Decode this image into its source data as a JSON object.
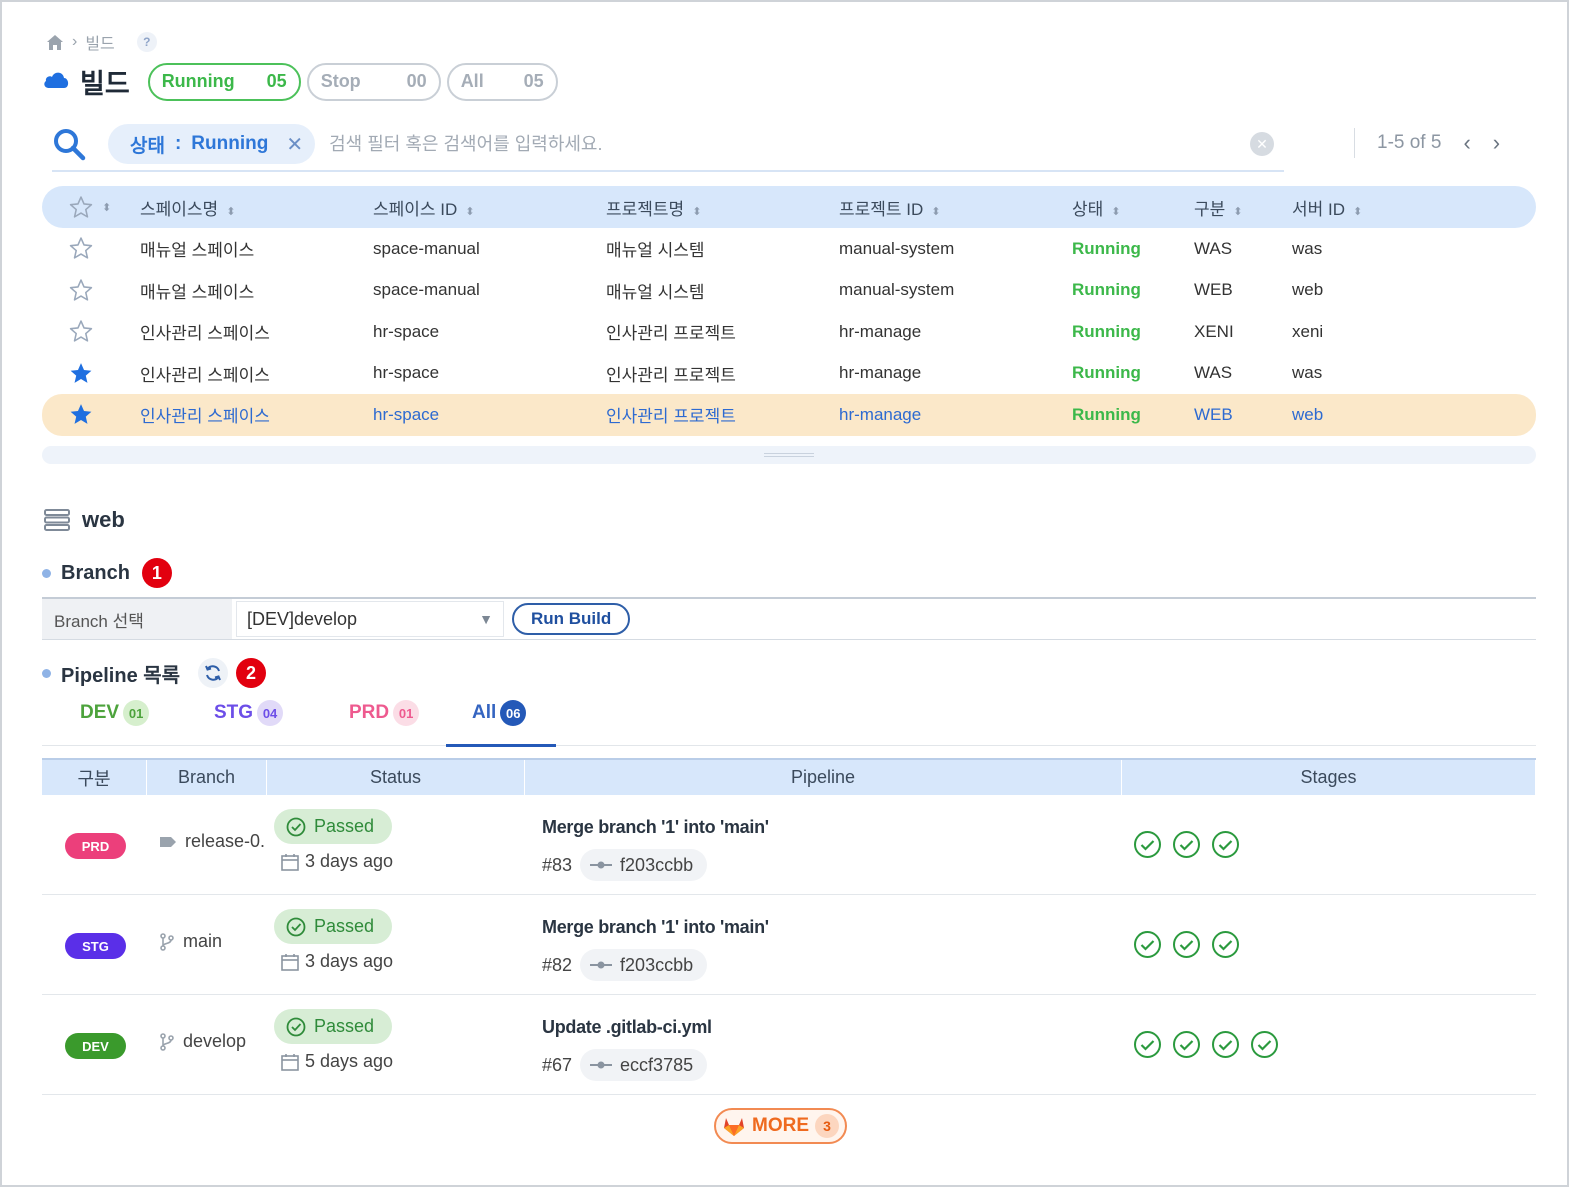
{
  "breadcrumb": {
    "current": "빌드",
    "help": "?"
  },
  "header": {
    "title": "빌드",
    "counters": [
      {
        "label": "Running",
        "count": "05"
      },
      {
        "label": "Stop",
        "count": "00"
      },
      {
        "label": "All",
        "count": "05"
      }
    ]
  },
  "search": {
    "chip_key": "상태",
    "chip_sep": ":",
    "chip_value": "Running",
    "chip_remove": "✕",
    "placeholder": "검색 필터 혹은 검색어를 입력하세요.",
    "clear": "✕"
  },
  "pager": {
    "text": "1-5 of 5",
    "prev": "‹",
    "next": "›"
  },
  "table": {
    "headers": [
      "스페이스명",
      "스페이스 ID",
      "프로젝트명",
      "프로젝트 ID",
      "상태",
      "구분",
      "서버 ID"
    ],
    "rows": [
      {
        "favorite": false,
        "space_name": "매뉴얼 스페이스",
        "space_id": "space-manual",
        "project_name": "매뉴얼 시스템",
        "project_id": "manual-system",
        "status": "Running",
        "type": "WAS",
        "server_id": "was"
      },
      {
        "favorite": false,
        "space_name": "매뉴얼 스페이스",
        "space_id": "space-manual",
        "project_name": "매뉴얼 시스템",
        "project_id": "manual-system",
        "status": "Running",
        "type": "WEB",
        "server_id": "web"
      },
      {
        "favorite": false,
        "space_name": "인사관리 스페이스",
        "space_id": "hr-space",
        "project_name": "인사관리 프로젝트",
        "project_id": "hr-manage",
        "status": "Running",
        "type": "XENI",
        "server_id": "xeni"
      },
      {
        "favorite": true,
        "space_name": "인사관리 스페이스",
        "space_id": "hr-space",
        "project_name": "인사관리 프로젝트",
        "project_id": "hr-manage",
        "status": "Running",
        "type": "WAS",
        "server_id": "was"
      },
      {
        "favorite": true,
        "space_name": "인사관리 스페이스",
        "space_id": "hr-space",
        "project_name": "인사관리 프로젝트",
        "project_id": "hr-manage",
        "status": "Running",
        "type": "WEB",
        "server_id": "web",
        "selected": true
      }
    ]
  },
  "detail": {
    "title": "web",
    "branch_section": {
      "label": "Branch",
      "marker": "1",
      "field_label": "Branch 선택",
      "selected": "[DEV]develop",
      "run_button": "Run Build"
    },
    "pipeline_section": {
      "label": "Pipeline 목록",
      "marker": "2"
    },
    "env_tabs": [
      {
        "label": "DEV",
        "count": "01"
      },
      {
        "label": "STG",
        "count": "04"
      },
      {
        "label": "PRD",
        "count": "01"
      },
      {
        "label": "All",
        "count": "06",
        "active": true
      }
    ],
    "pipeline_table": {
      "headers": [
        "구분",
        "Branch",
        "Status",
        "Pipeline",
        "Stages"
      ],
      "rows": [
        {
          "env": "PRD",
          "branch": "release-0.",
          "branch_icon": "tag-icon",
          "status": "Passed",
          "when": "3 days ago",
          "title": "Merge branch '1' into 'main'",
          "number": "#83",
          "commit": "f203ccbb",
          "stages": 3
        },
        {
          "env": "STG",
          "branch": "main",
          "branch_icon": "branch-icon",
          "status": "Passed",
          "when": "3 days ago",
          "title": "Merge branch '1' into 'main'",
          "number": "#82",
          "commit": "f203ccbb",
          "stages": 3
        },
        {
          "env": "DEV",
          "branch": "develop",
          "branch_icon": "branch-icon",
          "status": "Passed",
          "when": "5 days ago",
          "title": "Update .gitlab-ci.yml",
          "number": "#67",
          "commit": "eccf3785",
          "stages": 4
        }
      ]
    },
    "more": {
      "label": "MORE",
      "count": "3"
    }
  },
  "colors": {
    "running": "#3cb84a",
    "accent": "#2459b8",
    "prd": "#ec3f7b",
    "stg": "#5a2fe8",
    "dev": "#3a9a2c"
  }
}
